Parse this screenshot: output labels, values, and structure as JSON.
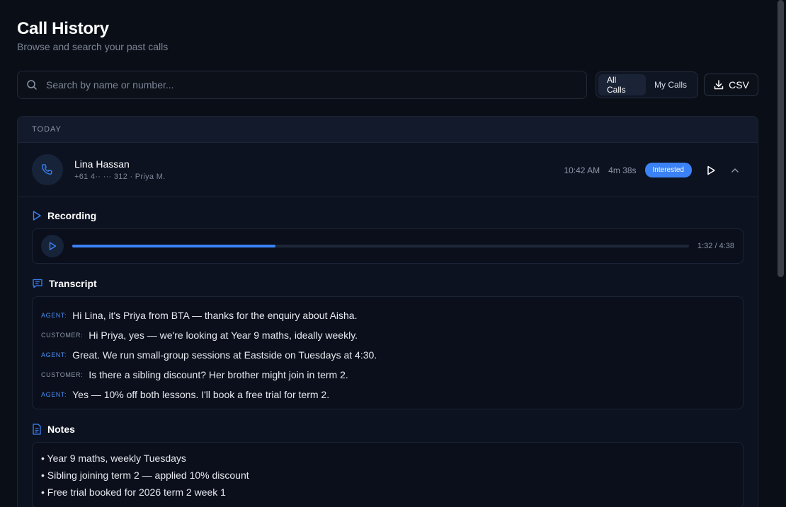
{
  "header": {
    "title": "Call History",
    "subtitle": "Browse and search your past calls"
  },
  "search": {
    "placeholder": "Search by name or number...",
    "value": ""
  },
  "filter": {
    "options": [
      "All Calls",
      "My Calls"
    ],
    "selected": "All Calls"
  },
  "export_button": {
    "label": "CSV",
    "icon": "download-icon"
  },
  "group": {
    "label": "TODAY"
  },
  "call": {
    "name": "Lina Hassan",
    "meta": "+61 4·· ··· 312 · Priya M.",
    "time": "10:42 AM",
    "duration": "4m 38s",
    "status": "Interested",
    "status_color": "#3b82f6"
  },
  "recording": {
    "heading": "Recording",
    "time_display": "1:32 / 4:38",
    "progress": 0.33
  },
  "transcript": {
    "heading": "Transcript",
    "lines": [
      {
        "speaker": "AGENT:",
        "role": "agent",
        "text": "Hi Lina, it's Priya from BTA — thanks for the enquiry about Aisha."
      },
      {
        "speaker": "CUSTOMER:",
        "role": "customer",
        "text": "Hi Priya, yes — we're looking at Year 9 maths, ideally weekly."
      },
      {
        "speaker": "AGENT:",
        "role": "agent",
        "text": "Great. We run small-group sessions at Eastside on Tuesdays at 4:30."
      },
      {
        "speaker": "CUSTOMER:",
        "role": "customer",
        "text": "Is there a sibling discount? Her brother might join in term 2."
      },
      {
        "speaker": "AGENT:",
        "role": "agent",
        "text": "Yes — 10% off both lessons. I'll book a free trial for term 2."
      }
    ]
  },
  "notes": {
    "heading": "Notes",
    "items": [
      "• Year 9 maths, weekly Tuesdays",
      "• Sibling joining term 2 — applied 10% discount",
      "• Free trial booked for 2026 term 2 week 1"
    ]
  },
  "colors": {
    "accent": "#3b82f6",
    "background": "#0a0e17",
    "card": "#0c1220"
  }
}
